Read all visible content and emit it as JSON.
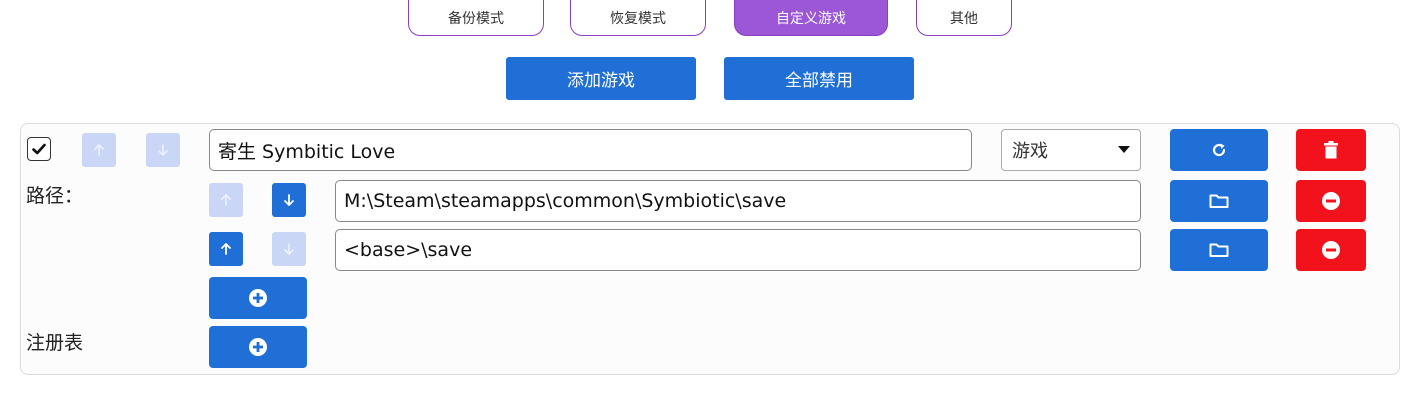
{
  "tabs": {
    "backup": "备份模式",
    "restore": "恢复模式",
    "custom": "自定义游戏",
    "other": "其他"
  },
  "actions": {
    "add_game": "添加游戏",
    "disable_all": "全部禁用"
  },
  "game": {
    "enabled": true,
    "name": "寄生 Symbitic Love",
    "category": "游戏",
    "paths_label": "路径：",
    "paths": [
      "M:\\Steam\\steamapps\\common\\Symbiotic\\save",
      "<base>\\save"
    ],
    "registry_label": "注册表"
  },
  "colors": {
    "accent": "#1f6fd6",
    "danger": "#f2121b",
    "tab_active": "#9b57d6",
    "arrow_disabled": "#c9d6f5"
  },
  "icons": {
    "check": "check-icon",
    "up": "arrow-up-icon",
    "down": "arrow-down-icon",
    "refresh": "refresh-icon",
    "delete": "trash-icon",
    "folder": "folder-icon",
    "remove": "minus-circle-icon",
    "add": "plus-circle-icon",
    "dropdown": "caret-down-icon"
  }
}
